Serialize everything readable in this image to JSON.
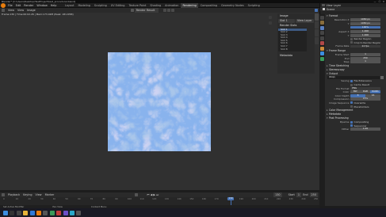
{
  "window": {
    "title": "Blender* [C:\\Users\\Desktop\\TestProject\\test_procedural.blend]",
    "buttons": [
      "—",
      "☐",
      "✕"
    ]
  },
  "menu": {
    "items": [
      "File",
      "Edit",
      "Render",
      "Window",
      "Help"
    ],
    "workspaces": [
      "Layout",
      "Modeling",
      "Sculpting",
      "UV Editing",
      "Texture Paint",
      "Shading",
      "Animation",
      "Rendering",
      "Compositing",
      "Geometry Nodes",
      "Scripting"
    ],
    "active_workspace": "Rendering",
    "scene": "Scene",
    "view_layer": "ViewLayer"
  },
  "image_editor": {
    "mode": "View",
    "menus": [
      "View",
      "View",
      "Image"
    ],
    "image_name": "Render Result",
    "slot": "Slot 1",
    "stat_line": "Frame:130 | Time:00:02.26 | Mem:173.02M (Peak: 181.65M)",
    "texture_colors": {
      "base": "#a9c6ea",
      "light": "#cfe1f6",
      "mid": "#6d9de0",
      "deep": "#1f63cf",
      "lilac": "#c9b8ec"
    }
  },
  "node_panel": {
    "title": "Image",
    "slot_label": "Slot 1",
    "layer_label": "View Layer",
    "slots_header": "Render Slots",
    "slots": [
      "Slot 1",
      "Slot 2",
      "Slot 3",
      "Slot 4",
      "Slot 5",
      "Slot 6",
      "Slot 7",
      "Slot 8"
    ],
    "metadata_label": "Metadata"
  },
  "timeline": {
    "menus": [
      "Playback",
      "Keying",
      "View",
      "Marker"
    ],
    "ticks": [
      "0",
      "10",
      "20",
      "30",
      "40",
      "50",
      "60",
      "70",
      "80",
      "90",
      "100",
      "110",
      "120",
      "130",
      "140",
      "150",
      "160",
      "170",
      "180",
      "190",
      "200",
      "210",
      "220",
      "230",
      "240",
      "250"
    ],
    "current_frame": "130",
    "start_label": "Start",
    "start_value": "1",
    "end_label": "End",
    "end_value": "250"
  },
  "statusbar": {
    "left": "Set Active Modifier",
    "mid": "Pan View",
    "right": "Context Menu"
  },
  "outliner": {
    "title": "Scene",
    "filter_label": "View Layer"
  },
  "properties": {
    "format_header": "Format",
    "resolution_x_label": "Resolution X",
    "resolution_x": "1080 px",
    "resolution_y_label": "Y",
    "resolution_y": "1080 px",
    "percent_value": "100%",
    "aspect_x_label": "Aspect X",
    "aspect_x": "1.000",
    "aspect_y_label": "Y",
    "aspect_y": "1.000",
    "render_region_label": "Render Region",
    "crop_label": "Crop to Render Region",
    "frame_rate_label": "Frame Rate",
    "frame_rate": "24 fps",
    "frame_range_header": "Frame Range",
    "frame_start_label": "Frame Start",
    "frame_start": "1",
    "end_label": "End",
    "end_value": "250",
    "step_label": "Step",
    "step_value": "1",
    "time_stretching": "Time Stretching",
    "stereoscopy": "Stereoscopy",
    "output_header": "Output",
    "output_path": "/tmp\\",
    "saving_label": "Saving",
    "file_extensions": "File Extensions",
    "cache_result": "Cache Result",
    "file_format_label": "File Format",
    "file_format": "PNG",
    "color_label": "Color",
    "color_bw": "BW",
    "color_rgb": "RGB",
    "color_rgba": "RGBA",
    "color_depth_label": "Color Depth",
    "depth_8": "8",
    "depth_16": "16",
    "compression_label": "Compression",
    "compression": "15%",
    "image_sequence_label": "Image Sequence",
    "overwrite": "Overwrite",
    "placeholders": "Placeholders",
    "color_management": "Color Management",
    "metadata_header": "Metadata",
    "post_processing_header": "Post Processing",
    "pipeline_label": "Pipeline",
    "compositing": "Compositing",
    "sequencer": "Sequencer",
    "dither_label": "Dither",
    "dither": "1.00"
  }
}
